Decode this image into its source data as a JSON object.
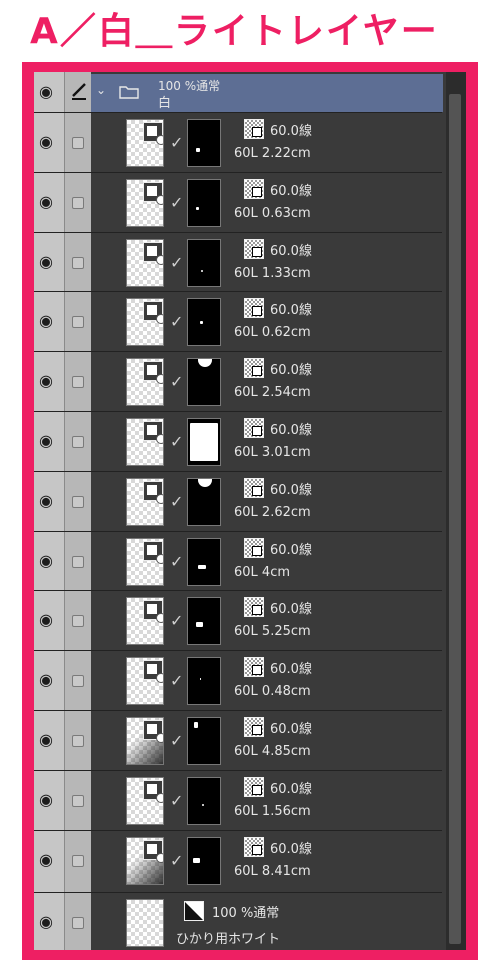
{
  "title": "A／白＿ライトレイヤー",
  "colors": {
    "accent": "#ee1f63",
    "panel_bg": "#3a3a3a",
    "header_bg": "#5d6e94"
  },
  "folder": {
    "opacity_mode": "100 %通常",
    "name": "白",
    "icon": "folder-icon",
    "expand_icon": "chevron-down-icon"
  },
  "layers": [
    {
      "opacity_mode": "60.0線",
      "info": "60L 2.22cm"
    },
    {
      "opacity_mode": "60.0線",
      "info": "60L 0.63cm"
    },
    {
      "opacity_mode": "60.0線",
      "info": "60L 1.33cm"
    },
    {
      "opacity_mode": "60.0線",
      "info": "60L 0.62cm"
    },
    {
      "opacity_mode": "60.0線",
      "info": "60L 2.54cm"
    },
    {
      "opacity_mode": "60.0線",
      "info": "60L 3.01cm"
    },
    {
      "opacity_mode": "60.0線",
      "info": "60L 2.62cm"
    },
    {
      "opacity_mode": "60.0線",
      "info": "60L 4cm"
    },
    {
      "opacity_mode": "60.0線",
      "info": "60L 5.25cm"
    },
    {
      "opacity_mode": "60.0線",
      "info": "60L 0.48cm"
    },
    {
      "opacity_mode": "60.0線",
      "info": "60L 4.85cm"
    },
    {
      "opacity_mode": "60.0線",
      "info": "60L 1.56cm"
    },
    {
      "opacity_mode": "60.0線",
      "info": "60L 8.41cm"
    }
  ],
  "bottom_layer": {
    "opacity_mode": "100 %通常",
    "name": "ひかり用ホワイト"
  }
}
